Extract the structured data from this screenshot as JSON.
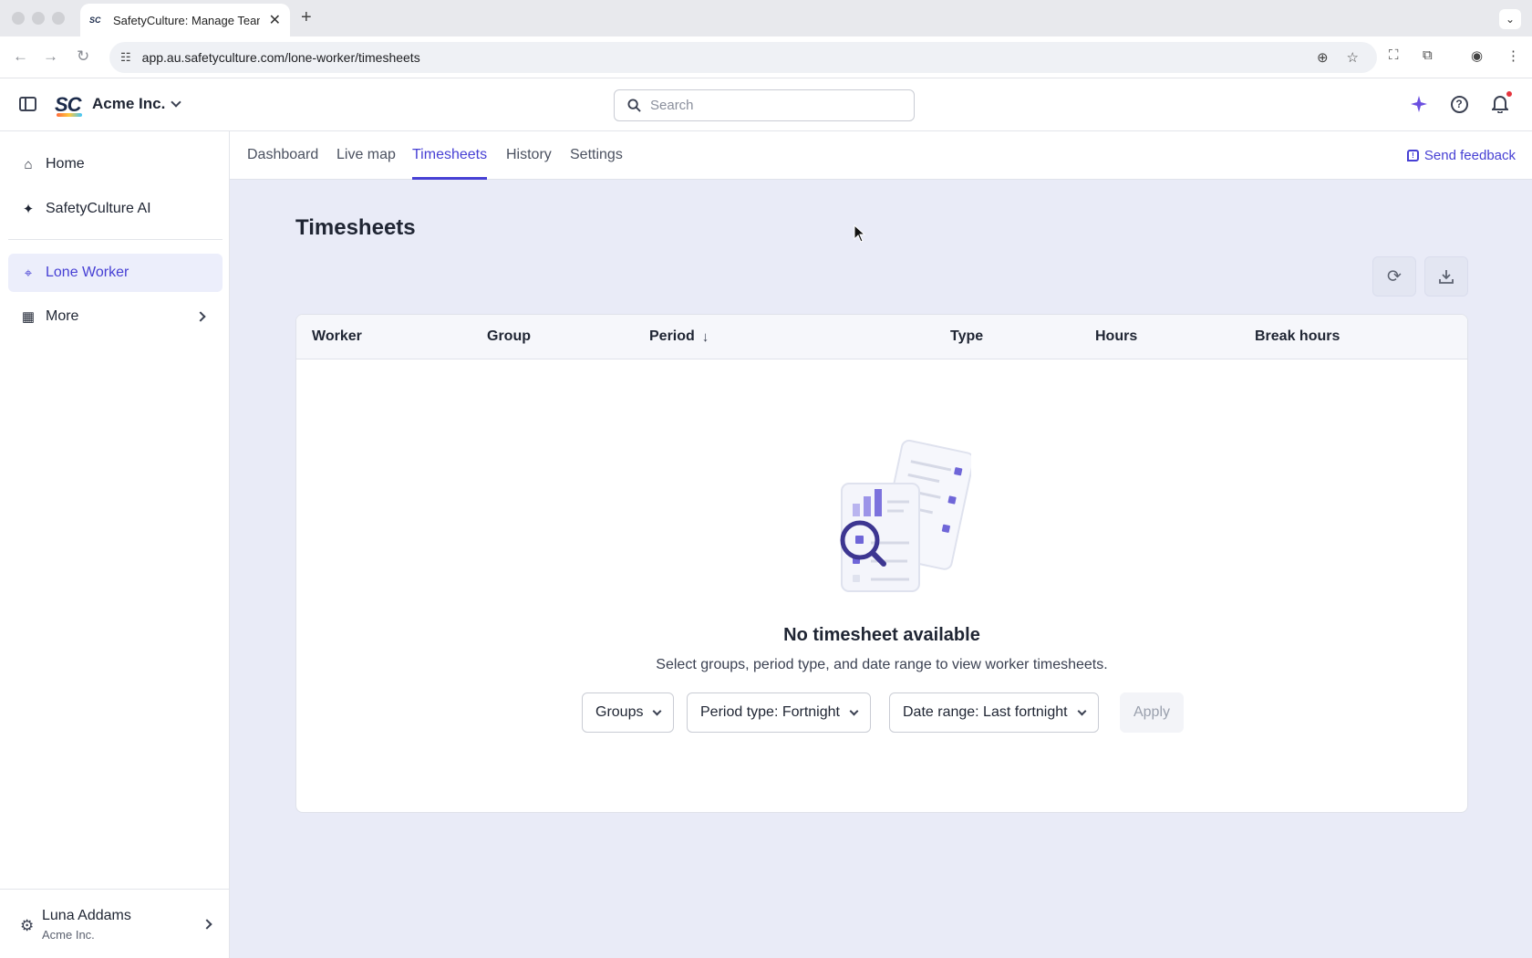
{
  "browser": {
    "tab_title": "SafetyCulture: Manage Teams",
    "favicon_text": "SC",
    "url": "app.au.safetyculture.com/lone-worker/timesheets"
  },
  "header": {
    "logo_text": "SC",
    "org_name": "Acme Inc.",
    "search_placeholder": "Search"
  },
  "sidebar": {
    "items": [
      {
        "label": "Home"
      },
      {
        "label": "SafetyCulture AI"
      },
      {
        "label": "Lone Worker"
      },
      {
        "label": "More"
      }
    ],
    "user": {
      "name": "Luna Addams",
      "org": "Acme Inc."
    }
  },
  "subnav": {
    "tabs": [
      {
        "label": "Dashboard"
      },
      {
        "label": "Live map"
      },
      {
        "label": "Timesheets"
      },
      {
        "label": "History"
      },
      {
        "label": "Settings"
      }
    ],
    "feedback_label": "Send feedback"
  },
  "page": {
    "title": "Timesheets",
    "columns": [
      "Worker",
      "Group",
      "Period",
      "Type",
      "Hours",
      "Break hours"
    ],
    "empty_title": "No timesheet available",
    "empty_subtitle": "Select groups, period type, and date range to view worker timesheets.",
    "filters": {
      "groups": "Groups",
      "period_type": "Period type: Fortnight",
      "date_range": "Date range: Last fortnight",
      "apply": "Apply"
    }
  },
  "colors": {
    "accent": "#4740d4",
    "main_bg": "#e9ebf7",
    "notification_dot": "#e5343d"
  }
}
